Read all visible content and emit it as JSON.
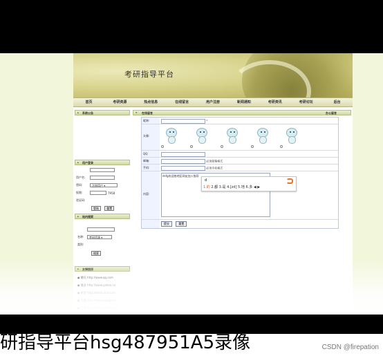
{
  "site": {
    "title": "考研指导平台",
    "nav": [
      "首页",
      "考研资源",
      "热点信息",
      "在线留言",
      "用户注册",
      "新闻通知",
      "考研资讯",
      "考研论坛",
      "后台"
    ]
  },
  "sidebar": {
    "system_notice_title": "系统公告",
    "login_title": "用户登录",
    "username_label": "用户名:",
    "password_label": "密码:",
    "role_label": "权限:",
    "role_value": "注册用户",
    "captcha_label": "验证码:",
    "captcha_value": "7958",
    "login_button": "登陆",
    "reset_button": "重置",
    "search_title": "站内搜索",
    "keyword_label": "名称:",
    "category_label": "类别:",
    "category_value": "考研资源",
    "search_button": "搜索",
    "links_title": "友情链接",
    "links": [
      "● 腾讯 http://www.qq.com",
      "● 雅虎 http://www.yahoo.cn",
      "● 新浪 http://www.sina.com",
      "● 谷歌 http://www.google.cn",
      "● 百度 http://www.baidu.com"
    ]
  },
  "main": {
    "header_left": "在线留言",
    "header_right": "办公留言",
    "fields": {
      "nickname_label": "昵称:",
      "avatar_label": "头像:",
      "qq_label": "QQ:",
      "email_label": "邮箱:",
      "email_hint": "必须邮箱格式",
      "phone_label": "手机:",
      "phone_hint": "必须手机格式",
      "content_label": "内容:",
      "content_value": "dsfg欢迎各地区网友加入指导"
    },
    "ime": {
      "pinyin": "d",
      "candidates_first": "1.的",
      "candidates_rest": " 2.都 3.是 4.[zd] 5.地 6.多 ◀ ▶"
    },
    "submit_button": "提交",
    "reset_button": "重置"
  },
  "caption": "研指导平台hsg487951A5录像",
  "watermark": "CSDN @firepation"
}
